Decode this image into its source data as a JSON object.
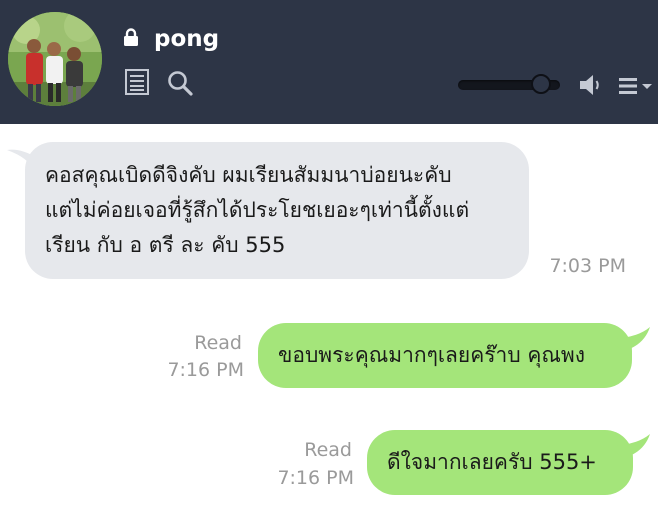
{
  "header": {
    "contact_name": "pong",
    "colors": {
      "background": "#2d3546",
      "text": "#ffffff"
    },
    "volume_level": 0.88
  },
  "messages": [
    {
      "direction": "incoming",
      "lines": [
        "คอสคุณเบิดดีจิงคับ ผมเรียนสัมมนาบ่อยนะคับ",
        "แต่ไม่ค่อยเจอที่รู้สึกได้ประโยชเยอะๆเท่านี้ตั้งแต่",
        "เรียน กับ อ ตรี ละ คับ 555"
      ],
      "time": "7:03 PM"
    },
    {
      "direction": "outgoing",
      "text": "ขอบพระคุณมากๆเลยคร๊าบ คุณพง",
      "read_label": "Read",
      "time": "7:16 PM"
    },
    {
      "direction": "outgoing",
      "text": "ดีใจมากเลยครับ 555+",
      "read_label": "Read",
      "time": "7:16 PM"
    }
  ],
  "colors": {
    "incoming_bubble": "#e6e8ec",
    "outgoing_bubble": "#a4e57a",
    "meta_text": "#9a9a9a"
  },
  "icons": [
    "lock-icon",
    "notes-icon",
    "search-icon",
    "speaker-icon",
    "menu-icon",
    "chevron-down-icon"
  ]
}
